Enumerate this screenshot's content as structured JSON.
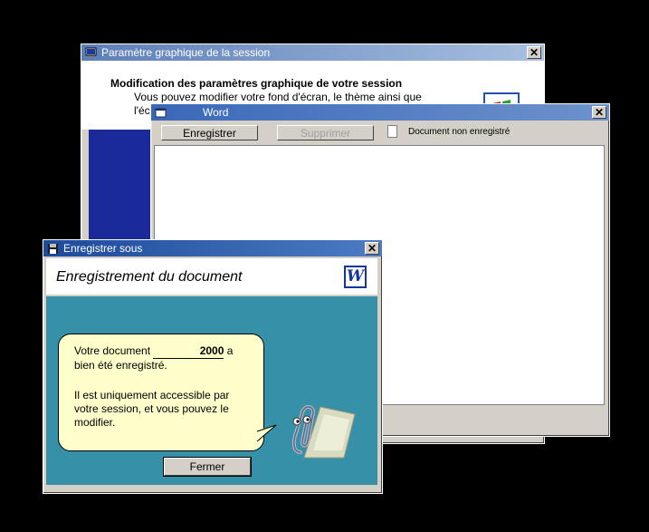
{
  "windows": {
    "settings": {
      "title": "Paramètre graphique de la session",
      "heading": "Modification des paramètres graphique de votre session",
      "subtext": "Vous pouvez modifier votre fond d'écran, le thème ainsi que l'écr"
    },
    "word": {
      "title": "Word",
      "save_label": "Enregistrer",
      "delete_label": "Supprimer",
      "status_text": "Document non enregistré"
    },
    "save_as": {
      "title": "Enregistrer sous",
      "heading": "Enregistrement du document",
      "logo_letter": "W",
      "message_before": "Votre document ",
      "document_number": "2000",
      "message_after": " a bien été enregistré.",
      "message_2": "Il est uniquement accessible par votre session, et vous pouvez le modifier.",
      "close_label": "Fermer"
    }
  },
  "close_glyph": "✕",
  "colors": {
    "dialog_body": "#3590a8",
    "bubble": "#ffffcc",
    "word_blue": "#14369c"
  }
}
